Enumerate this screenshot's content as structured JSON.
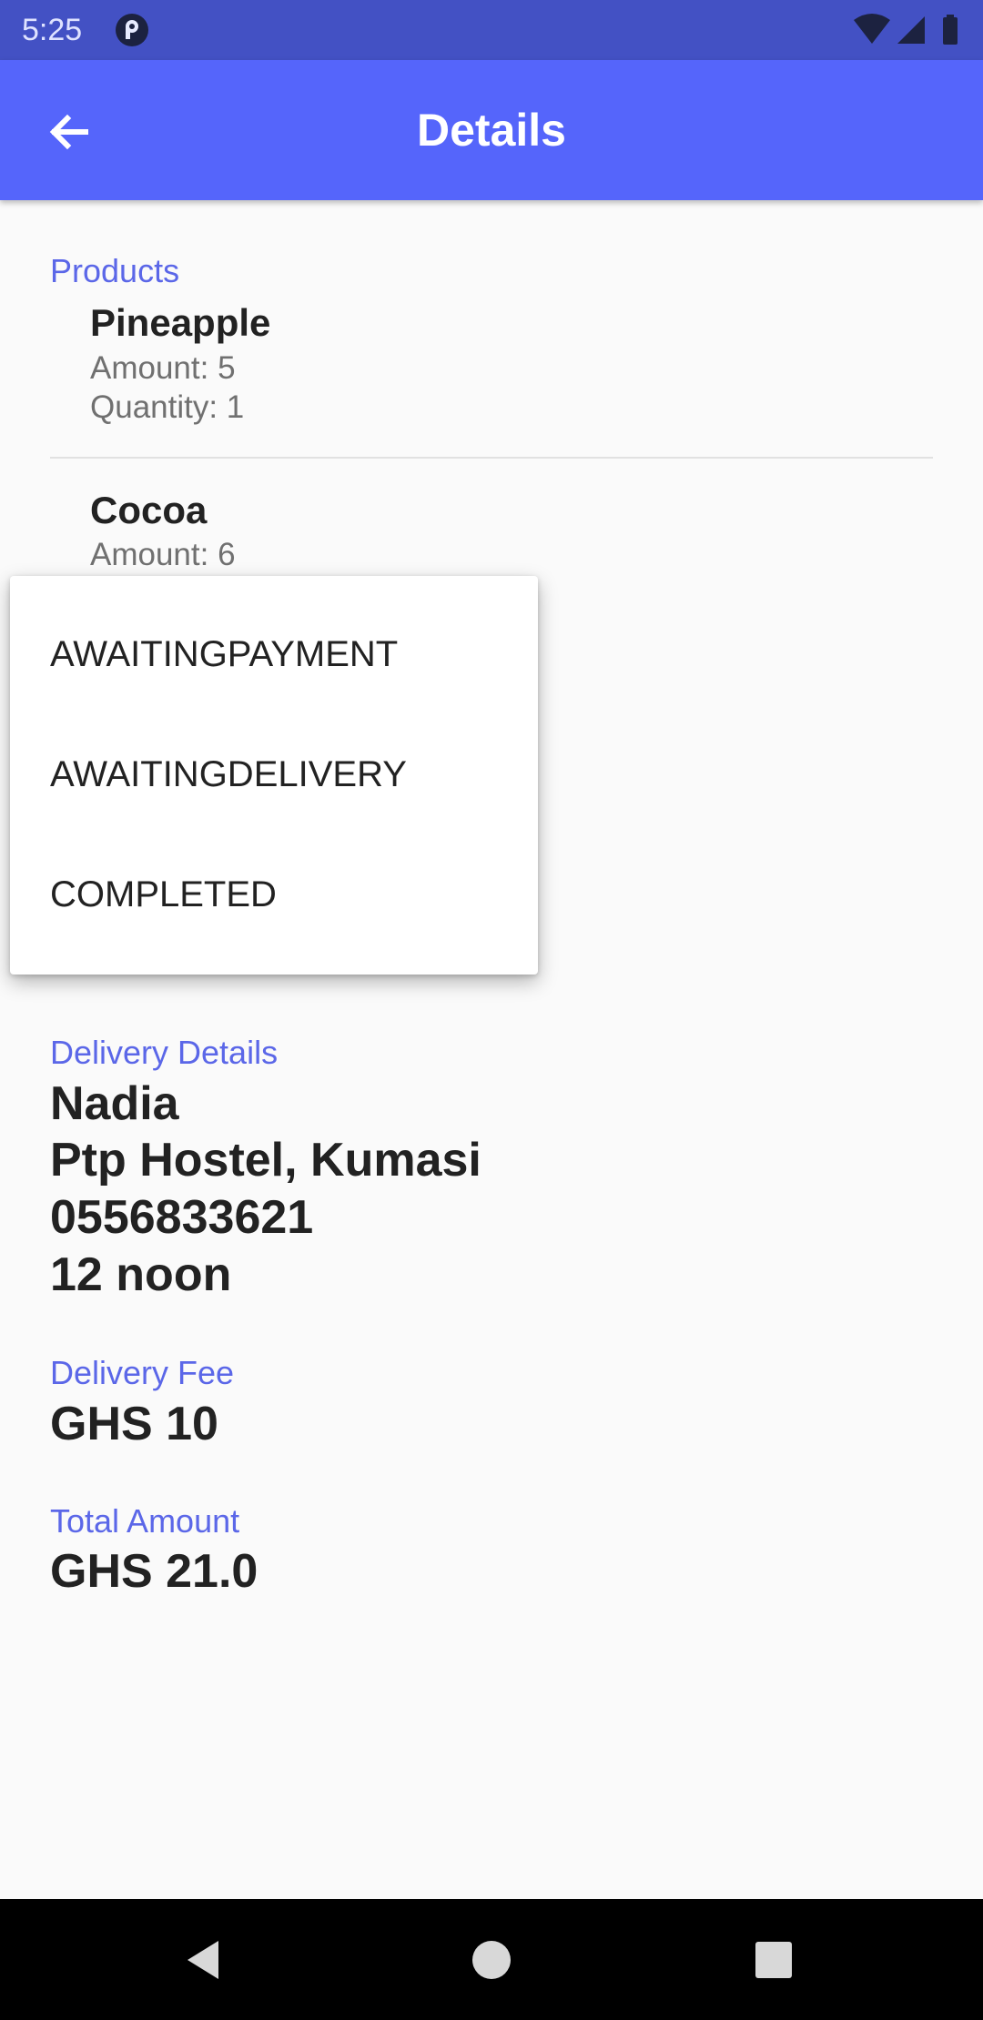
{
  "status_bar": {
    "time": "5:25",
    "app_icon": "notification-app-icon",
    "icons": [
      "wifi-icon",
      "cellular-signal-icon",
      "battery-icon"
    ]
  },
  "app_bar": {
    "title": "Details",
    "back_icon": "arrow-left-icon"
  },
  "products": {
    "label": "Products",
    "items": [
      {
        "name": "Pineapple",
        "amount": "Amount: 5",
        "quantity": "Quantity: 1"
      },
      {
        "name": "Cocoa",
        "amount": "Amount: 6"
      }
    ]
  },
  "status_menu": {
    "options": [
      "AWAITINGPAYMENT",
      "AWAITINGDELIVERY",
      "COMPLETED"
    ]
  },
  "delivery": {
    "label": "Delivery Details",
    "name": "Nadia",
    "address": "Ptp Hostel, Kumasi",
    "phone": "0556833621",
    "time": "12 noon"
  },
  "fee": {
    "label": "Delivery Fee",
    "value": "GHS 10"
  },
  "total": {
    "label": "Total Amount",
    "value": "GHS 21.0"
  },
  "nav_bar": {
    "buttons": [
      "back-triangle-icon",
      "home-circle-icon",
      "recents-square-icon"
    ]
  },
  "colors": {
    "status_bar": "#4351c4",
    "app_bar": "#5565fb",
    "accent_label": "#5b67e8",
    "background": "#fafafa"
  }
}
